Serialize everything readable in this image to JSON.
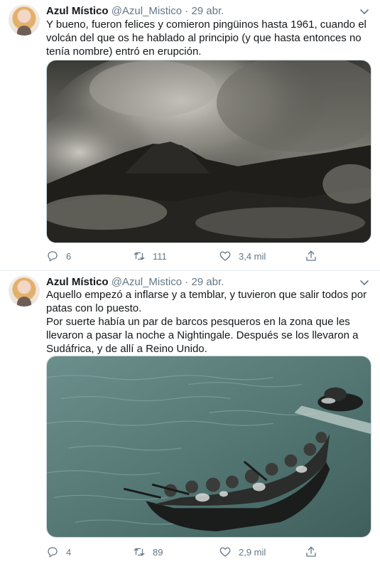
{
  "tweets": [
    {
      "name": "Azul Místico",
      "handle": "@Azul_Mistico",
      "dot": "·",
      "date": "29 abr.",
      "lines": [
        "Y bueno, fueron felices y comieron pingüinos hasta 1961, cuando el volcán del que os he hablado al principio (y que hasta entonces no tenía nombre) entró en erupción."
      ],
      "replies": "6",
      "retweets": "111",
      "likes": "3,4 mil"
    },
    {
      "name": "Azul Místico",
      "handle": "@Azul_Mistico",
      "dot": "·",
      "date": "29 abr.",
      "lines": [
        "Aquello empezó a inflarse y a temblar, y tuvieron que salir todos por patas con lo puesto.",
        "Por suerte había un par de barcos pesqueros en la zona que les llevaron a pasar la noche a Nightingale. Después se los llevaron a Sudáfrica, y de allí a Reino Unido."
      ],
      "replies": "4",
      "retweets": "89",
      "likes": "2,9 mil"
    }
  ],
  "icons": {
    "reply": "reply-icon",
    "retweet": "retweet-icon",
    "like": "like-icon",
    "share": "share-icon",
    "caret": "chevron-down-icon"
  },
  "colors": {
    "text": "#14171a",
    "secondary": "#657786",
    "border": "#e6ecf0"
  }
}
